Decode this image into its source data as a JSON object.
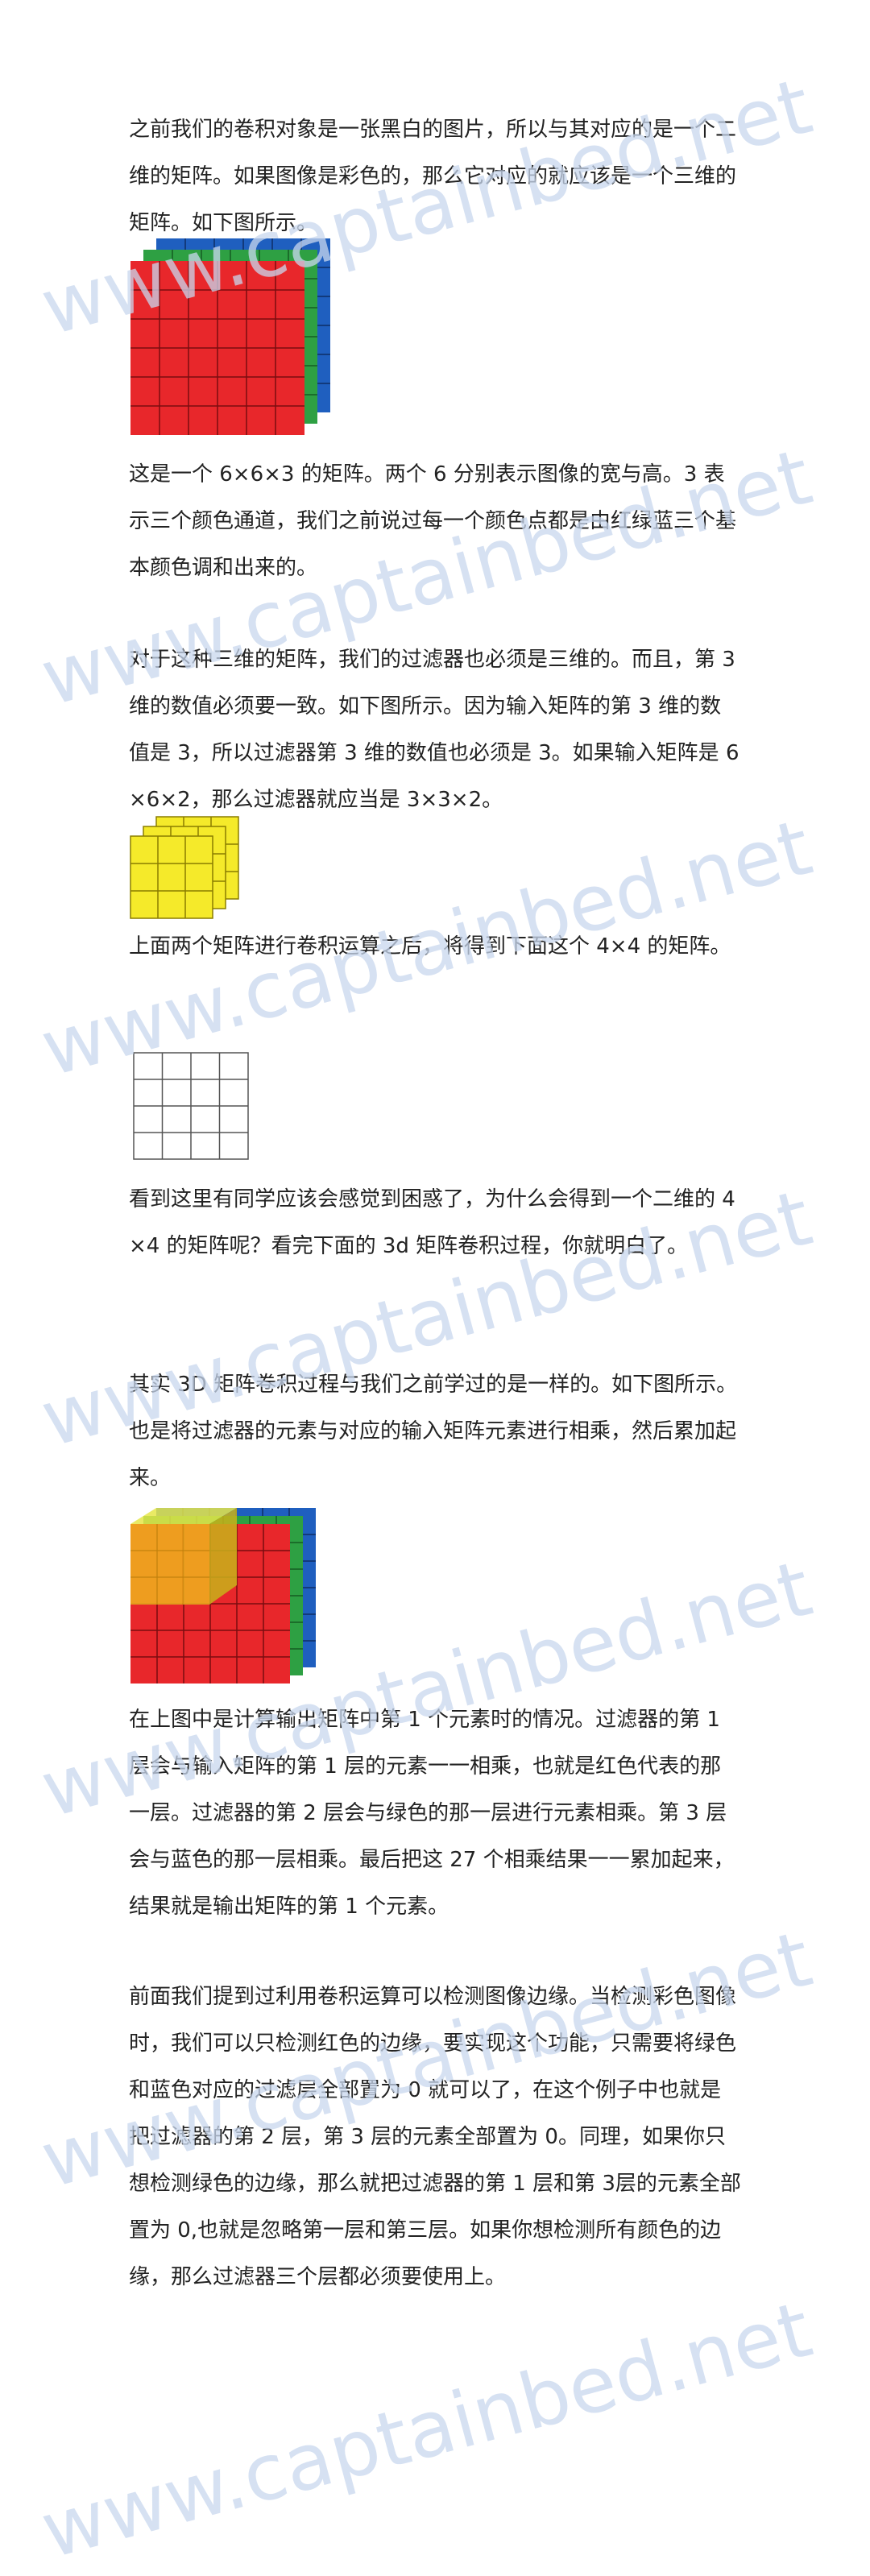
{
  "article": {
    "paragraphs": [
      "之前我们的卷积对象是一张黑白的图片，所以与其对应的是一个二维的矩阵。如果图像是彩色的，那么它对应的就应该是一个三维的矩阵。如下图所示。",
      "这是一个 6×6×3 的矩阵。两个 6 分别表示图像的宽与高。3 表示三个颜色通道，我们之前说过每一个颜色点都是由红绿蓝三个基本颜色调和出来的。",
      "对于这种三维的矩阵，我们的过滤器也必须是三维的。而且，第 3 维的数值必须要一致。如下图所示。因为输入矩阵的第 3 维的数值是 3，所以过滤器第 3 维的数值也必须是 3。如果输入矩阵是 6×6×2，那么过滤器就应当是 3×3×2。",
      "上面两个矩阵进行卷积运算之后，将得到下面这个 4×4 的矩阵。",
      "看到这里有同学应该会感觉到困惑了，为什么会得到一个二维的 4×4 的矩阵呢？看完下面的 3d 矩阵卷积过程，你就明白了。",
      "其实 3D 矩阵卷积过程与我们之前学过的是一样的。如下图所示。也是将过滤器的元素与对应的输入矩阵元素进行相乘，然后累加起来。",
      "在上图中是计算输出矩阵中第 1 个元素时的情况。过滤器的第 1 层会与输入矩阵的第 1 层的元素一一相乘，也就是红色代表的那一层。过滤器的第 2 层会与绿色的那一层进行元素相乘。第 3 层会与蓝色的那一层相乘。最后把这 27 个相乘结果一一累加起来，结果就是输出矩阵的第 1 个元素。",
      "前面我们提到过利用卷积运算可以检测图像边缘。当检测彩色图像时，我们可以只检测红色的边缘，要实现这个功能，只需要将绿色和蓝色对应的过滤层全部置为 0 就可以了，在这个例子中也就是把过滤器的第 2 层，第 3 层的元素全部置为 0。同理，如果你只想检测绿色的边缘，那么就把过滤器的第 1 层和第 3层的元素全部置为 0,也就是忽略第一层和第三层。如果你想检测所有颜色的边缘，那么过滤器三个层都必须要使用上。"
    ]
  },
  "watermark": {
    "text": "www.captainbed.net"
  },
  "colors": {
    "red": "#e8272b",
    "green": "#2ea043",
    "blue": "#1f5fbf",
    "yellow": "#f5ea2a",
    "orange": "#f0b21e",
    "grid_line": "#555555"
  }
}
